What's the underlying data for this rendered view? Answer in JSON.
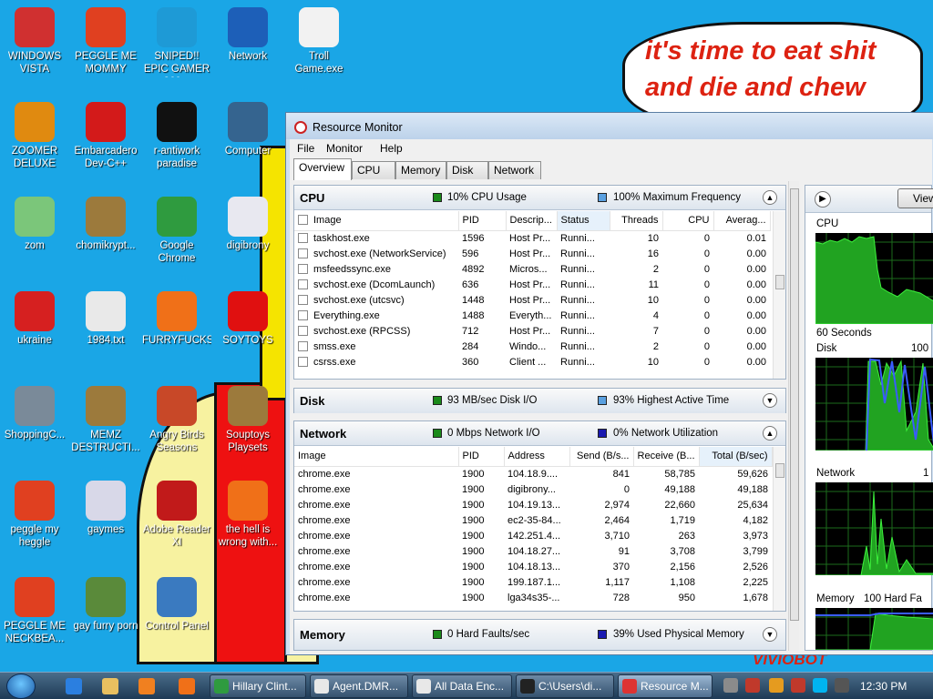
{
  "speech": {
    "line1": "it's time to eat shit",
    "line2": "and die and chew"
  },
  "bottom_text": "VIVIOBOT",
  "desktop_icons": [
    {
      "id": "windows-vista",
      "label": "WINDOWS VISTA",
      "color": "#d03030"
    },
    {
      "id": "peggle-mommy",
      "label": "PEGGLE ME MOMMY",
      "color": "#e04020"
    },
    {
      "id": "sniped",
      "label": "SNIPED!! EPIC GAMER 360...",
      "color": "#1e9ad6"
    },
    {
      "id": "network",
      "label": "Network",
      "color": "#1d5fb8"
    },
    {
      "id": "troll-game",
      "label": "Troll Game.exe",
      "color": "#f2f2f2"
    },
    {
      "id": "zoomer-deluxe",
      "label": "ZOOMER DELUXE",
      "color": "#e08a10"
    },
    {
      "id": "dev-cpp",
      "label": "Embarcadero Dev-C++",
      "color": "#d31a1a"
    },
    {
      "id": "r-antiwork",
      "label": "r-antiwork paradise",
      "color": "#111111"
    },
    {
      "id": "computer",
      "label": "Computer",
      "color": "#35648f"
    },
    {
      "id": "zom",
      "label": "zom",
      "color": "#7bc67a"
    },
    {
      "id": "chomikrypt",
      "label": "chomikrypt...",
      "color": "#9c7a3c"
    },
    {
      "id": "google-chrome",
      "label": "Google Chrome",
      "color": "#2f9b3f"
    },
    {
      "id": "digibrony",
      "label": "digibrony",
      "color": "#e8e8f0"
    },
    {
      "id": "ukraine",
      "label": "ukraine",
      "color": "#d62020"
    },
    {
      "id": "file-1984",
      "label": "1984.txt",
      "color": "#e9e9e9"
    },
    {
      "id": "furryfucks",
      "label": "FURRYFUCKS",
      "color": "#f07018"
    },
    {
      "id": "soytoys",
      "label": "SOYTOYS",
      "color": "#e01010"
    },
    {
      "id": "shockwave",
      "label": "ShoppingC...",
      "color": "#7a8a99"
    },
    {
      "id": "memz",
      "label": "MEMZ DESTRUCTI...",
      "color": "#9c7a3c"
    },
    {
      "id": "angry-birds",
      "label": "Angry Birds Seasons",
      "color": "#c84828"
    },
    {
      "id": "souptoys",
      "label": "Souptoys Playsets",
      "color": "#9c7a3c"
    },
    {
      "id": "peggle-heggle",
      "label": "peggle my heggle",
      "color": "#e04020"
    },
    {
      "id": "gaymes",
      "label": "gaymes",
      "color": "#d8d8e8"
    },
    {
      "id": "adobe-reader",
      "label": "Adobe Reader XI",
      "color": "#c11a1a"
    },
    {
      "id": "the-hell",
      "label": "the hell is wrong with...",
      "color": "#f07018"
    },
    {
      "id": "peggle-neckbeard",
      "label": "PEGGLE ME NECKBEA...",
      "color": "#e04020"
    },
    {
      "id": "gay-furry-porn",
      "label": "gay furry porn",
      "color": "#5a8a3a"
    },
    {
      "id": "control-panel",
      "label": "Control Panel",
      "color": "#3a7ac0"
    }
  ],
  "taskbar": {
    "buttons": [
      {
        "label": "Hillary Clint...",
        "color": "#2f9b3f"
      },
      {
        "label": "Agent.DMR...",
        "color": "#e8e8e8"
      },
      {
        "label": "All Data Enc...",
        "color": "#e8e8e8"
      },
      {
        "label": "C:\\Users\\di...",
        "color": "#222222"
      },
      {
        "label": "Resource M...",
        "color": "#d33"
      }
    ],
    "time": "12:30 PM"
  },
  "resource_monitor": {
    "title": "Resource Monitor",
    "menu": [
      "File",
      "Monitor",
      "Help"
    ],
    "tabs": [
      "Overview",
      "CPU",
      "Memory",
      "Disk",
      "Network"
    ],
    "cpu": {
      "name": "CPU",
      "usage": "10% CPU Usage",
      "usage_color": "#1a8a1a",
      "frequency": "100% Maximum Frequency",
      "frequency_color": "#5aa0e0",
      "columns": [
        "Image",
        "PID",
        "Descrip...",
        "Status",
        "Threads",
        "CPU",
        "Averag..."
      ],
      "rows": [
        [
          "taskhost.exe",
          "1596",
          "Host Pr...",
          "Runni...",
          "10",
          "0",
          "0.01"
        ],
        [
          "svchost.exe (NetworkService)",
          "596",
          "Host Pr...",
          "Runni...",
          "16",
          "0",
          "0.00"
        ],
        [
          "msfeedssync.exe",
          "4892",
          "Micros...",
          "Runni...",
          "2",
          "0",
          "0.00"
        ],
        [
          "svchost.exe (DcomLaunch)",
          "636",
          "Host Pr...",
          "Runni...",
          "11",
          "0",
          "0.00"
        ],
        [
          "svchost.exe (utcsvc)",
          "1448",
          "Host Pr...",
          "Runni...",
          "10",
          "0",
          "0.00"
        ],
        [
          "Everything.exe",
          "1488",
          "Everyth...",
          "Runni...",
          "4",
          "0",
          "0.00"
        ],
        [
          "svchost.exe (RPCSS)",
          "712",
          "Host Pr...",
          "Runni...",
          "7",
          "0",
          "0.00"
        ],
        [
          "smss.exe",
          "284",
          "Windo...",
          "Runni...",
          "2",
          "0",
          "0.00"
        ],
        [
          "csrss.exe",
          "360",
          "Client ...",
          "Runni...",
          "10",
          "0",
          "0.00"
        ]
      ]
    },
    "disk": {
      "name": "Disk",
      "io": "93 MB/sec Disk I/O",
      "io_color": "#1a8a1a",
      "active": "93% Highest Active Time",
      "active_color": "#5aa0e0"
    },
    "network": {
      "name": "Network",
      "io": "0 Mbps Network I/O",
      "io_color": "#1a8a1a",
      "util": "0% Network Utilization",
      "util_color": "#1a1ab0",
      "columns": [
        "Image",
        "PID",
        "Address",
        "Send (B/s...",
        "Receive (B...",
        "Total (B/sec)"
      ],
      "rows": [
        [
          "chrome.exe",
          "1900",
          "104.18.9....",
          "841",
          "58,785",
          "59,626"
        ],
        [
          "chrome.exe",
          "1900",
          "digibrony...",
          "0",
          "49,188",
          "49,188"
        ],
        [
          "chrome.exe",
          "1900",
          "104.19.13...",
          "2,974",
          "22,660",
          "25,634"
        ],
        [
          "chrome.exe",
          "1900",
          "ec2-35-84...",
          "2,464",
          "1,719",
          "4,182"
        ],
        [
          "chrome.exe",
          "1900",
          "142.251.4...",
          "3,710",
          "263",
          "3,973"
        ],
        [
          "chrome.exe",
          "1900",
          "104.18.27...",
          "91",
          "3,708",
          "3,799"
        ],
        [
          "chrome.exe",
          "1900",
          "104.18.13...",
          "370",
          "2,156",
          "2,526"
        ],
        [
          "chrome.exe",
          "1900",
          "199.187.1...",
          "1,117",
          "1,108",
          "2,225"
        ],
        [
          "chrome.exe",
          "1900",
          "lga34s35-...",
          "728",
          "950",
          "1,678"
        ]
      ]
    },
    "memory": {
      "name": "Memory",
      "faults": "0 Hard Faults/sec",
      "faults_color": "#1a8a1a",
      "used": "39% Used Physical Memory",
      "used_color": "#1a1ab0"
    },
    "graphs": {
      "view_button": "View",
      "cpu_label": "CPU",
      "seconds_label": "60 Seconds",
      "disk_label": "Disk",
      "disk_scale": "100",
      "network_label": "Network",
      "network_scale": "1",
      "memory_label": "Memory",
      "memory_scale": "100 Hard Fa"
    }
  }
}
